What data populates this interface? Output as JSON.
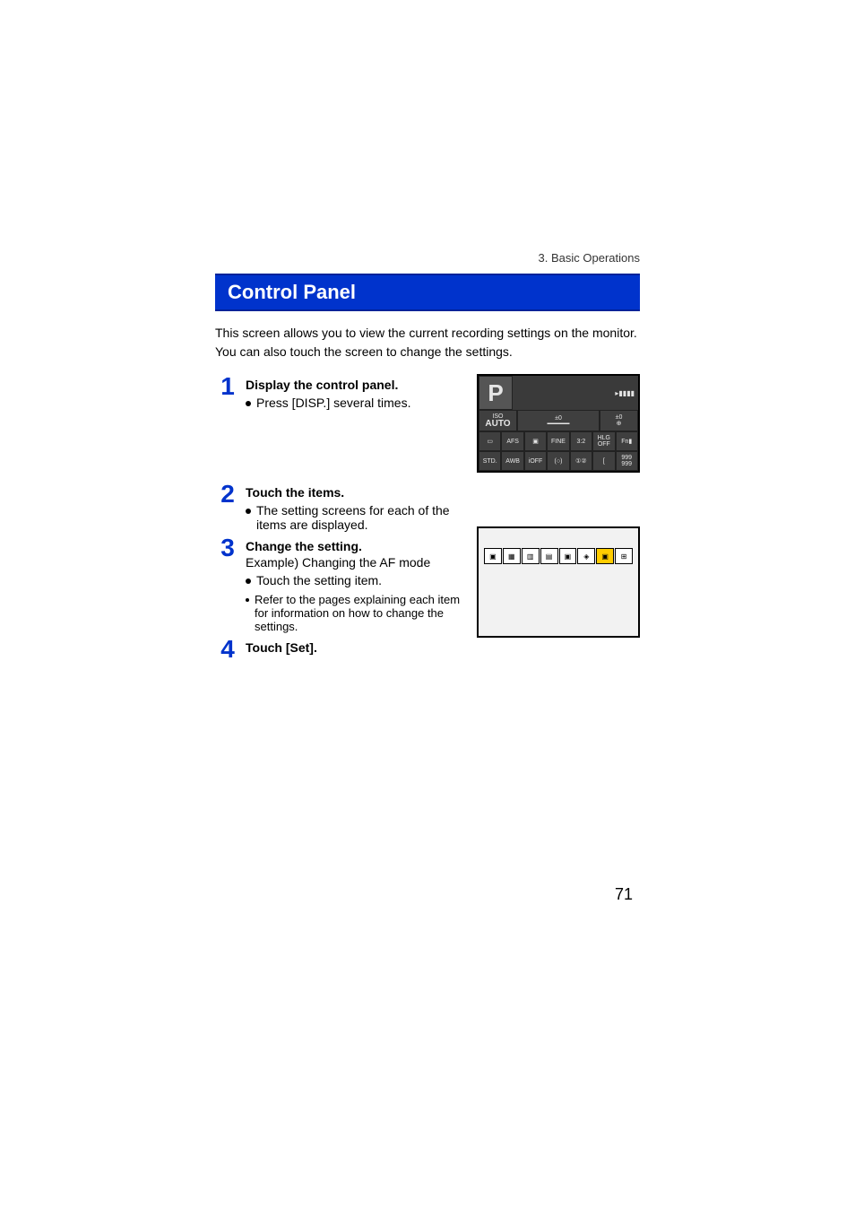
{
  "breadcrumb": "3. Basic Operations",
  "title": "Control Panel",
  "intro": "This screen allows you to view the current recording settings on the monitor. You can also touch the screen to change the settings.",
  "steps": {
    "s1": {
      "num": "1",
      "heading": "Display the control panel.",
      "bullet1": "Press [DISP.] several times."
    },
    "s2": {
      "num": "2",
      "heading": "Touch the items.",
      "bullet1": "The setting screens for each of the items are displayed."
    },
    "s3": {
      "num": "3",
      "heading": "Change the setting.",
      "line1": "Example) Changing the AF mode",
      "bullet1": "Touch the setting item.",
      "note1": "Refer to the pages explaining each item for information on how to change the settings."
    },
    "s4": {
      "num": "4",
      "heading": "Touch [Set]."
    }
  },
  "panel": {
    "mode": "P",
    "battery_icon": "▸▮▮▮▮",
    "iso_label": "ISO",
    "iso_value": "AUTO",
    "ev_value": "±0",
    "ex_label": "±0",
    "row3": {
      "c1": "▭",
      "c2": "AFS",
      "c3": "▣",
      "c4": "FINE",
      "c5": "3:2",
      "c6": "HLG OFF",
      "c7": "Fn▮"
    },
    "row4": {
      "c1": "STD.",
      "c2": "AWB",
      "c3": "iOFF",
      "c4": "(○)",
      "c5": "①②",
      "c6": "[",
      "c7": "999 999"
    }
  },
  "af_icons": [
    "▣",
    "▦",
    "▥",
    "▤",
    "▣",
    "◈",
    "▣",
    "⊞"
  ],
  "page_number": "71"
}
